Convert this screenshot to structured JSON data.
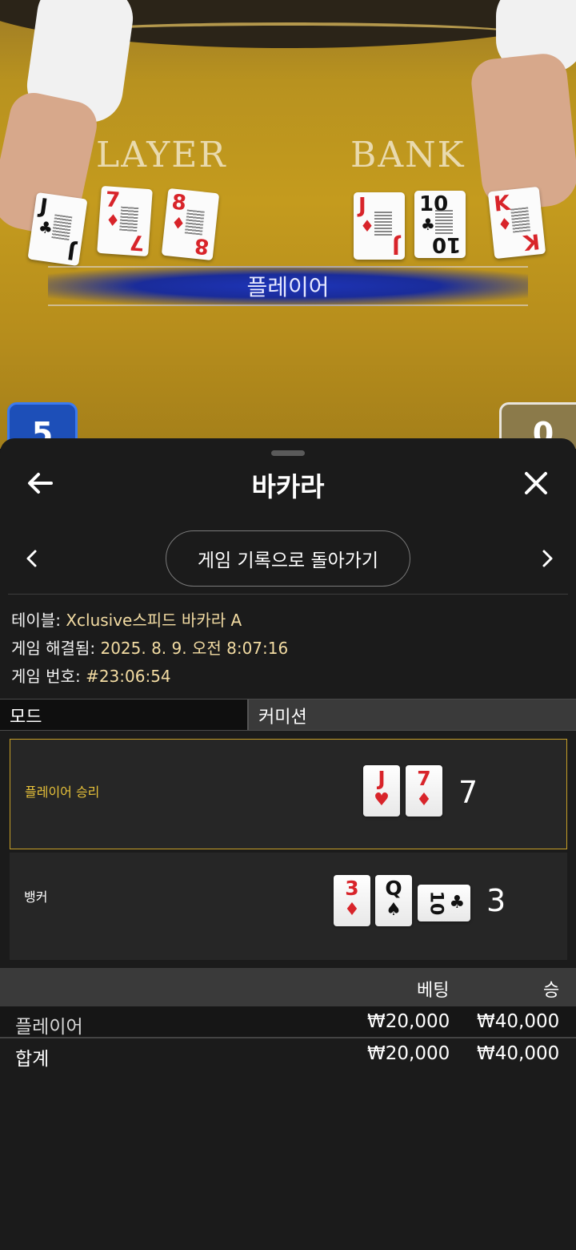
{
  "video": {
    "player_word": "LAYER",
    "banker_word": "BANK",
    "result_banner": "플레이어",
    "player_score": "5",
    "banker_score": "0",
    "player_cards": [
      {
        "rank": "J",
        "suit": "♣",
        "color": "black"
      },
      {
        "rank": "7",
        "suit": "♦",
        "color": "red"
      },
      {
        "rank": "8",
        "suit": "♦",
        "color": "red"
      }
    ],
    "banker_cards": [
      {
        "rank": "J",
        "suit": "♦",
        "color": "red"
      },
      {
        "rank": "10",
        "suit": "♣",
        "color": "black"
      },
      {
        "rank": "K",
        "suit": "♦",
        "color": "red"
      }
    ]
  },
  "sheet": {
    "title": "바카라",
    "back_icon": "arrow-left-icon",
    "close_icon": "close-icon",
    "history_button": "게임 기록으로 돌아가기",
    "info": {
      "table_label": "테이블:",
      "table_value": "Xclusive스피드 바카라 A",
      "resolved_label": "게임 해결됨:",
      "resolved_value": "2025. 8. 9. 오전 8:07:16",
      "number_label": "게임 번호:",
      "number_value": "#23:06:54"
    },
    "mode_label": "모드",
    "commission_label": "커미션",
    "player_hand": {
      "label": "플레이어 승리",
      "score": "7",
      "cards": [
        {
          "rank": "J",
          "suit": "♥",
          "color": "red"
        },
        {
          "rank": "7",
          "suit": "♦",
          "color": "red"
        }
      ]
    },
    "banker_hand": {
      "label": "뱅커",
      "score": "3",
      "cards": [
        {
          "rank": "3",
          "suit": "♦",
          "color": "red"
        },
        {
          "rank": "Q",
          "suit": "♠",
          "color": "black"
        },
        {
          "rank": "10",
          "suit": "♣",
          "color": "black"
        }
      ]
    },
    "bets_table": {
      "headers": [
        "",
        "베팅",
        "승"
      ],
      "rows": [
        [
          "플레이어",
          "₩20,000",
          "₩40,000"
        ]
      ],
      "total": [
        "합계",
        "₩20,000",
        "₩40,000"
      ]
    },
    "colors": {
      "accent": "#c7a028",
      "background": "#1b1b1b",
      "player_blue": "#1d4fb8"
    }
  }
}
